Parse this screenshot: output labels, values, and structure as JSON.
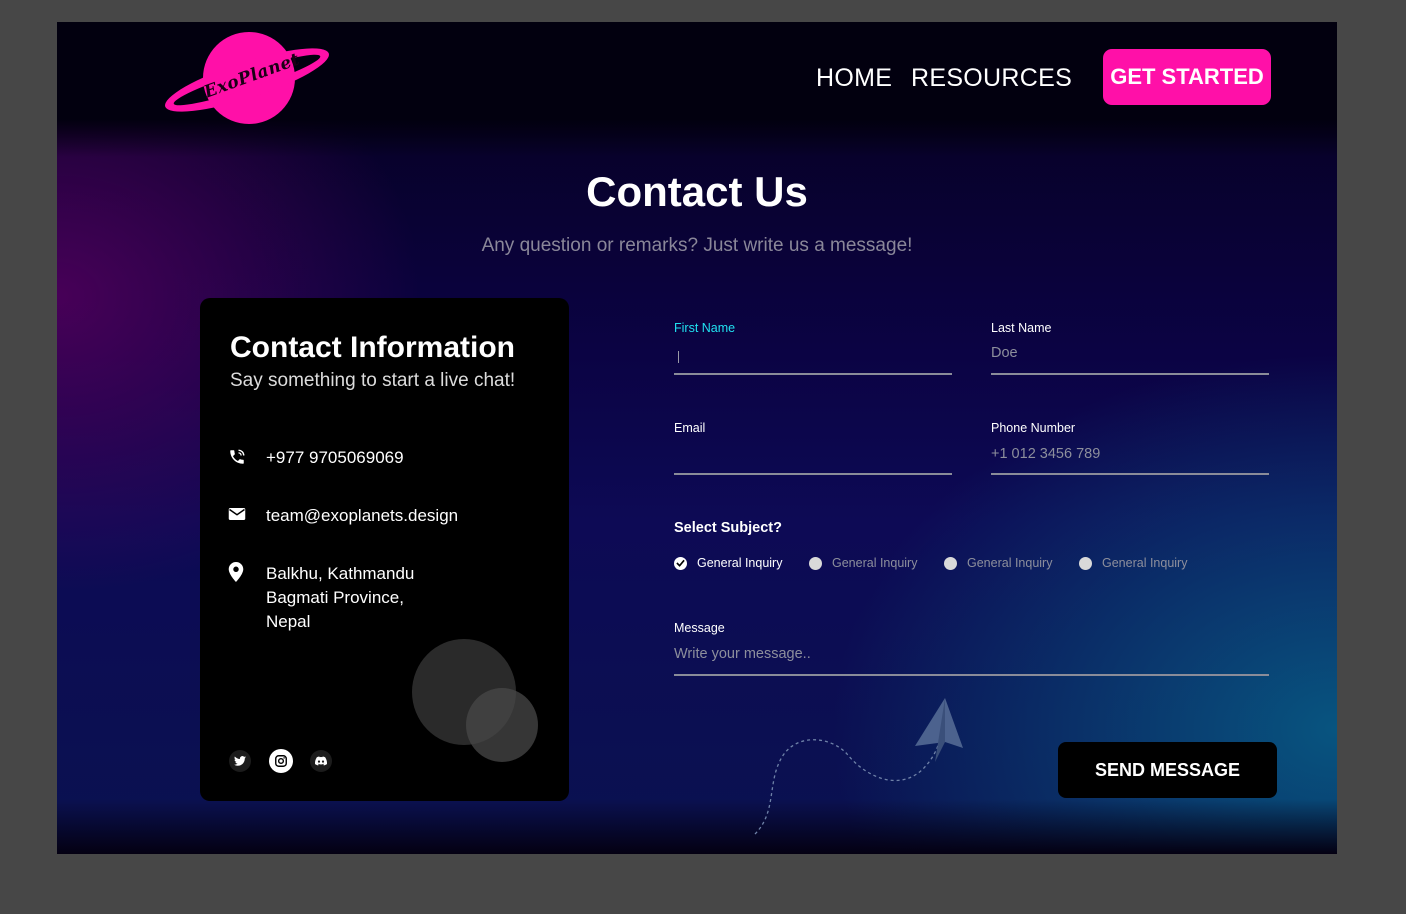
{
  "brand": {
    "logo_text": "ExoPlanet",
    "accent_color": "#ff10a8"
  },
  "nav": {
    "home": "HOME",
    "resources": "RESOURCES",
    "cta": "GET STARTED"
  },
  "hero": {
    "title": "Contact Us",
    "subtitle": "Any question or remarks? Just write us a message!"
  },
  "contact_card": {
    "title": "Contact Information",
    "subtitle": "Say something to start a live chat!",
    "phone": {
      "icon": "phone-icon",
      "text": "+977 9705069069"
    },
    "email": {
      "icon": "mail-icon",
      "text": "team@exoplanets.design"
    },
    "address": {
      "icon": "location-pin-icon",
      "lines": [
        "Balkhu, Kathmandu",
        "Bagmati Province,",
        "Nepal"
      ]
    },
    "socials": [
      "twitter-icon",
      "instagram-icon",
      "discord-icon"
    ]
  },
  "form": {
    "first_name": {
      "label": "First Name",
      "value": ""
    },
    "last_name": {
      "label": "Last Name",
      "placeholder": "Doe"
    },
    "email": {
      "label": "Email",
      "value": ""
    },
    "phone": {
      "label": "Phone Number",
      "placeholder": "+1 012 3456 789"
    },
    "subject": {
      "label": "Select Subject?",
      "options": [
        {
          "label": "General Inquiry",
          "checked": true
        },
        {
          "label": "General Inquiry",
          "checked": false
        },
        {
          "label": "General Inquiry",
          "checked": false
        },
        {
          "label": "General Inquiry",
          "checked": false
        }
      ]
    },
    "message": {
      "label": "Message",
      "placeholder": "Write your message.."
    },
    "submit": "SEND MESSAGE"
  }
}
